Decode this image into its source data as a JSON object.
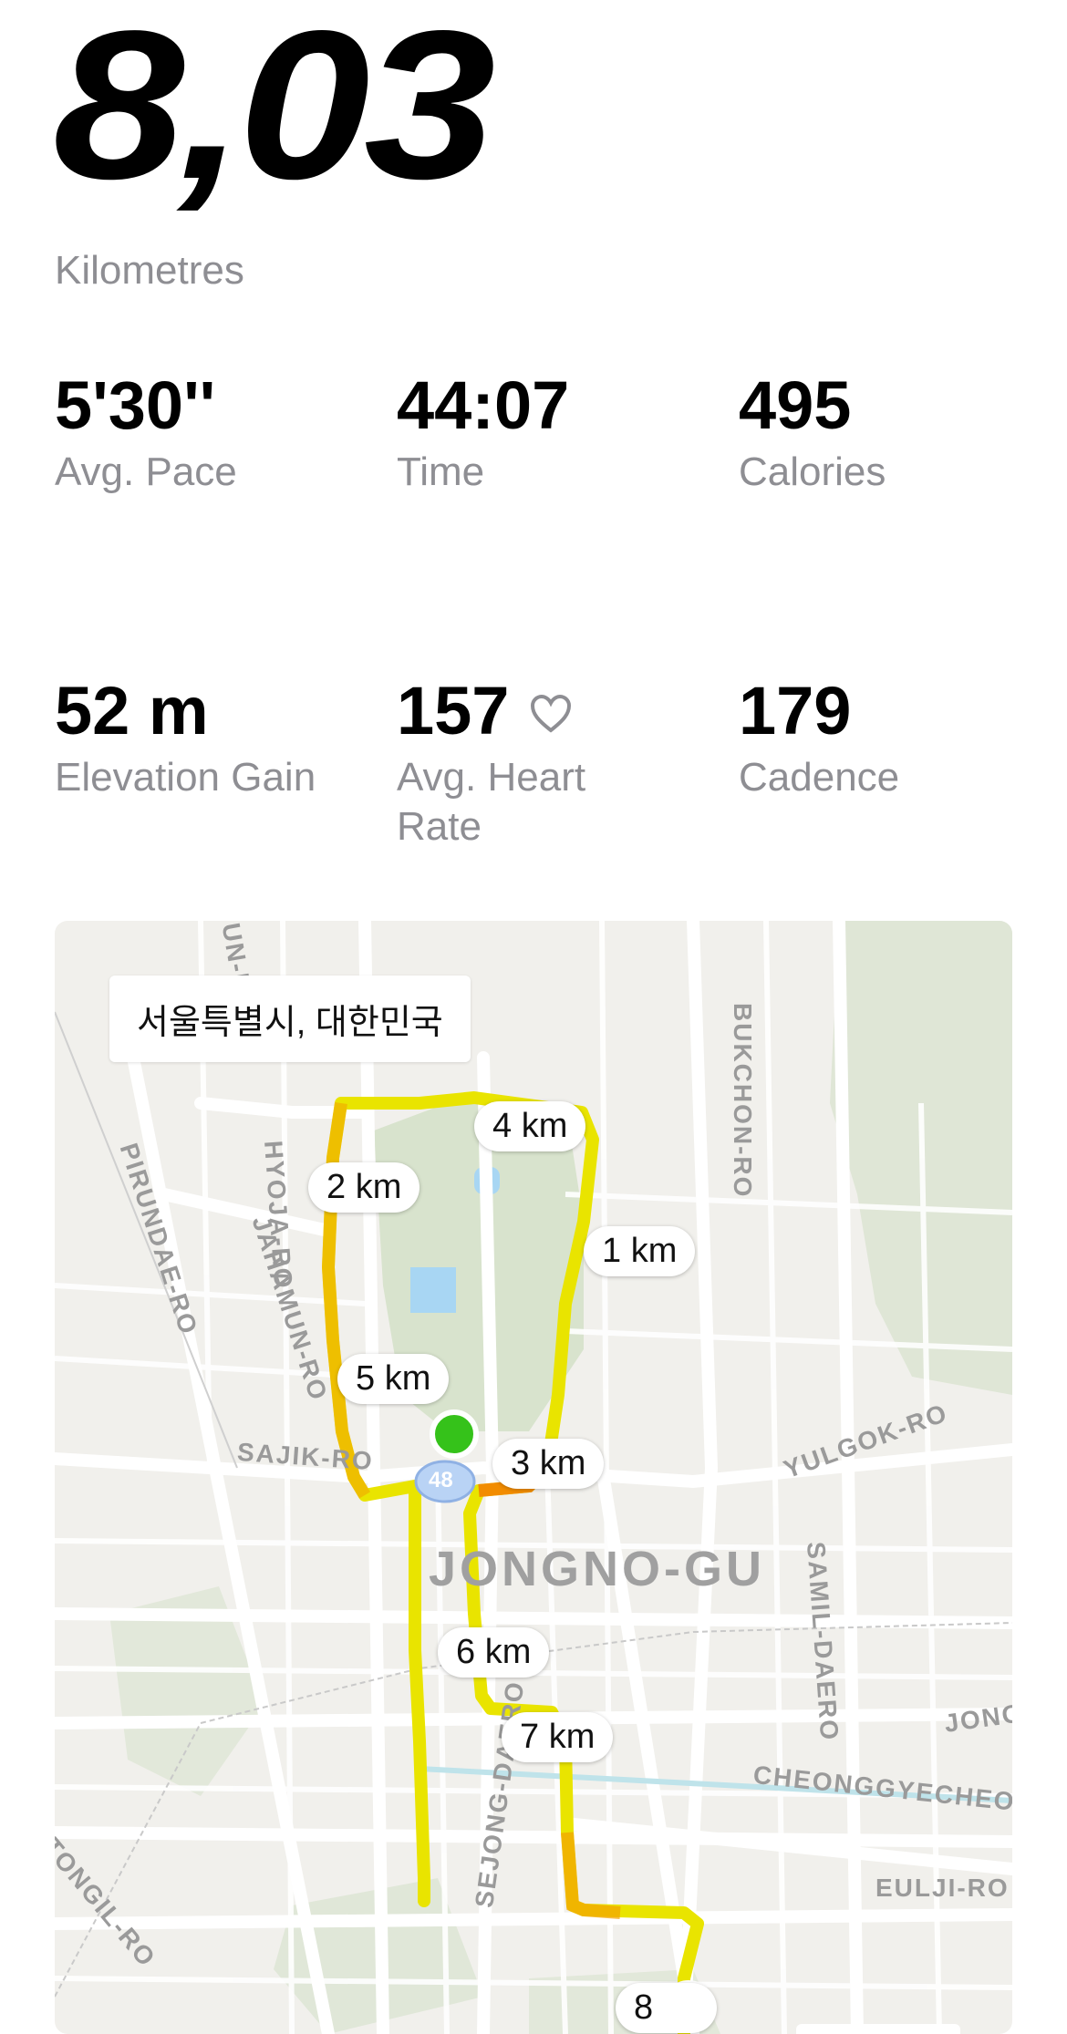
{
  "summary": {
    "distance": "8,03",
    "distance_unit": "Kilometres"
  },
  "stats": [
    {
      "value": "5'30''",
      "label": "Avg. Pace"
    },
    {
      "value": "44:07",
      "label": "Time"
    },
    {
      "value": "495",
      "label": "Calories"
    },
    {
      "value": "52 m",
      "label": "Elevation Gain"
    },
    {
      "value": "157",
      "label": "Avg. Heart Rate",
      "icon": "heart-icon"
    },
    {
      "value": "179",
      "label": "Cadence"
    }
  ],
  "map": {
    "location": "서울특별시, 대한민국",
    "district": "JONGNO-GU",
    "route_shield": "48",
    "km_markers": [
      "1 km",
      "2 km",
      "3 km",
      "4 km",
      "5 km",
      "6 km",
      "7 km",
      "8"
    ],
    "streets": [
      "BUKCHON-RO",
      "PIRUNDAE-RO",
      "JAHAMUN-RO",
      "HYOJA-RO",
      "SAJIK-RO",
      "YULGOK-RO",
      "SAMIL-DAERO",
      "CHEONGGYECHEON-RO",
      "EULJI-RO",
      "TONGIL-RO",
      "JONG-RO",
      "SEJONG-DAERO",
      "UN-RO"
    ],
    "colors": {
      "route_yellow": "#e9e400",
      "route_orange": "#f2a100",
      "start": "#35c21a",
      "end": "#ff1a1a"
    }
  }
}
